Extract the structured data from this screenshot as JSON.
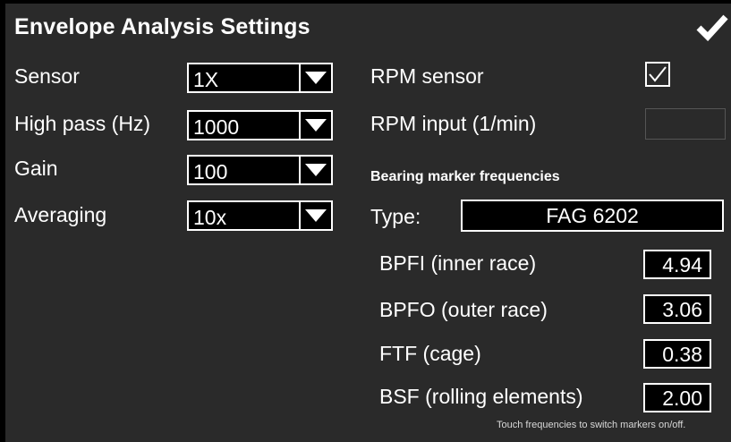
{
  "title": "Envelope Analysis Settings",
  "ok_icon": "checkmark-icon",
  "left": {
    "sensor": {
      "label": "Sensor",
      "value": "1X"
    },
    "high_pass": {
      "label": "High pass (Hz)",
      "value": "1000"
    },
    "gain": {
      "label": "Gain",
      "value": "100"
    },
    "averaging": {
      "label": "Averaging",
      "value": "10x"
    }
  },
  "right": {
    "rpm_sensor": {
      "label": "RPM sensor",
      "checked": true
    },
    "rpm_input": {
      "label": "RPM input (1/min)",
      "value": ""
    },
    "bearing_heading": "Bearing marker frequencies",
    "type": {
      "label": "Type:",
      "value": "FAG 6202"
    },
    "bpfi": {
      "label": "BPFI (inner race)",
      "value": "4.94"
    },
    "bpfo": {
      "label": "BPFO (outer race)",
      "value": "3.06"
    },
    "ftf": {
      "label": "FTF (cage)",
      "value": "0.38"
    },
    "bsf": {
      "label": "BSF (rolling elements)",
      "value": "2.00"
    },
    "note": "Touch frequencies to switch markers on/off."
  },
  "colors": {
    "background": "#2a2a2a",
    "field": "#000000",
    "text": "#ffffff"
  }
}
